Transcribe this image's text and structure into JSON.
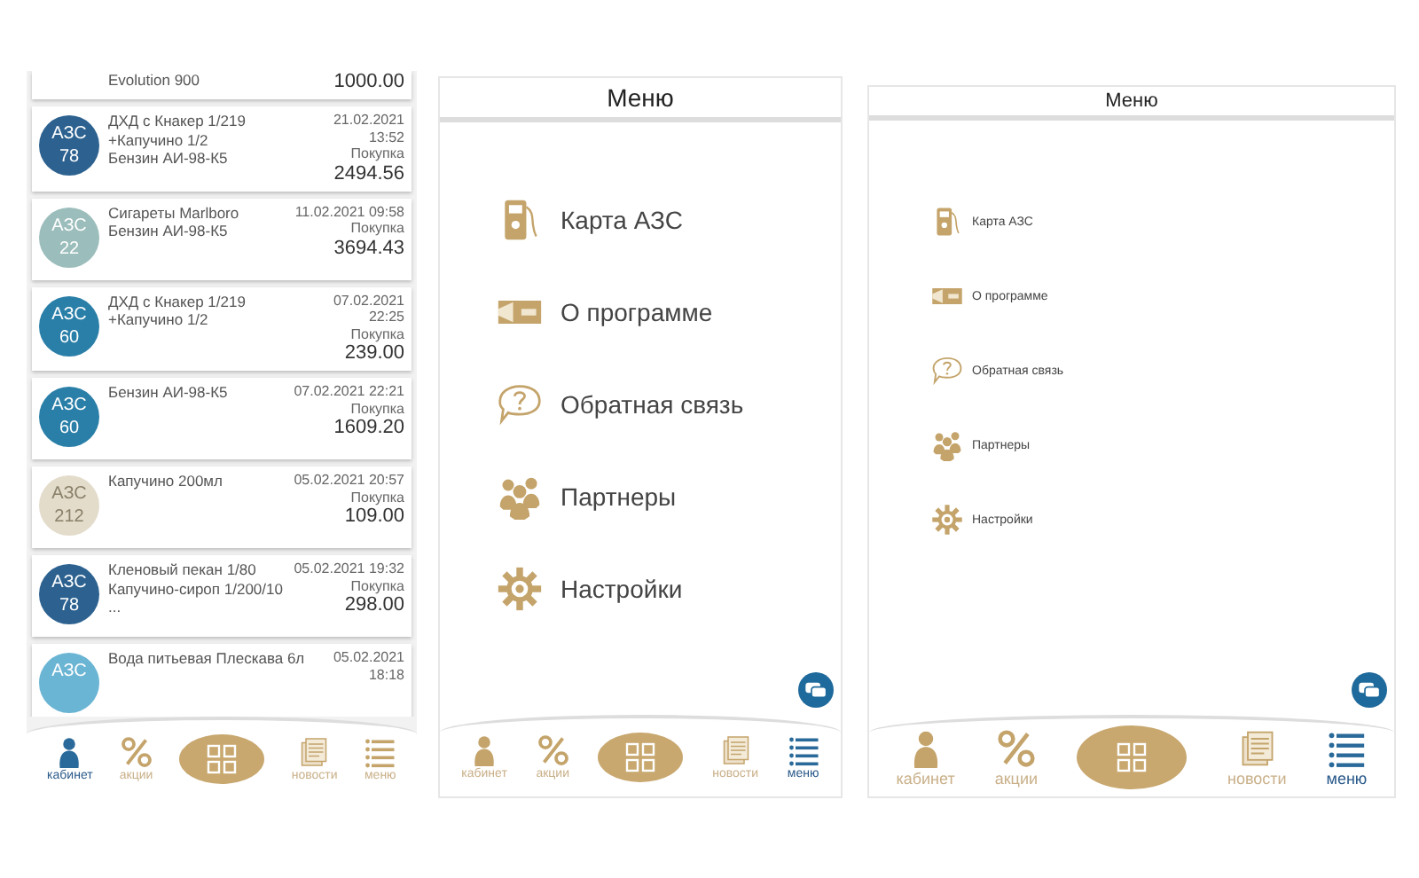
{
  "screens": [
    {
      "kind": "history",
      "transactions": [
        {
          "lines": [
            "Evolution 900"
          ],
          "amount": "1000.00"
        },
        {
          "station": "АЗС",
          "number": "78",
          "color": "#2d6290",
          "lines": [
            "ДХД с Кнакер 1/219",
            "+Капучино 1/2",
            "Бензин АИ-98-К5"
          ],
          "date": "21.02.2021",
          "time": "13:52",
          "type": "Покупка",
          "amount": "2494.56"
        },
        {
          "station": "АЗС",
          "number": "22",
          "color": "#9bbdbb",
          "lines": [
            "Сигареты Marlboro",
            "Бензин АИ-98-К5"
          ],
          "date": "11.02.2021 09:58",
          "type": "Покупка",
          "amount": "3694.43"
        },
        {
          "station": "АЗС",
          "number": "60",
          "color": "#2a7fa8",
          "lines": [
            "ДХД с Кнакер 1/219",
            "+Капучино 1/2"
          ],
          "date": "07.02.2021",
          "time": "22:25",
          "type": "Покупка",
          "amount": "239.00"
        },
        {
          "station": "АЗС",
          "number": "60",
          "color": "#2a7fa8",
          "lines": [
            "Бензин АИ-98-К5"
          ],
          "date": "07.02.2021 22:21",
          "type": "Покупка",
          "amount": "1609.20"
        },
        {
          "station": "АЗС",
          "number": "212",
          "color": "#e3dccb",
          "lines": [
            "Капучино 200мл"
          ],
          "date": "05.02.2021 20:57",
          "type": "Покупка",
          "amount": "109.00"
        },
        {
          "station": "АЗС",
          "number": "78",
          "color": "#2d6290",
          "lines": [
            "Кленовый пекан 1/80",
            "Капучино-сироп 1/200/10",
            "..."
          ],
          "date": "05.02.2021 19:32",
          "type": "Покупка",
          "amount": "298.00"
        },
        {
          "station": "АЗС",
          "color": "#6bb5d4",
          "lines": [
            "Вода питьевая Плескава 6л"
          ],
          "date": "05.02.2021",
          "time": "18:18"
        }
      ],
      "nav": [
        {
          "kind": "person",
          "label": "кабинет",
          "selected": true
        },
        {
          "kind": "percent",
          "label": "акции",
          "selected": false
        },
        {
          "kind": "qr",
          "selected": false
        },
        {
          "kind": "news",
          "label": "новости",
          "selected": false
        },
        {
          "kind": "menu",
          "label": "меню",
          "selected": false
        }
      ]
    },
    {
      "kind": "menu",
      "title": "Меню",
      "items": [
        {
          "kind": "map",
          "label": "Карта АЗС"
        },
        {
          "kind": "about",
          "label": "О программе"
        },
        {
          "kind": "feedback",
          "label": "Обратная связь"
        },
        {
          "kind": "partners",
          "label": "Партнеры"
        },
        {
          "kind": "settings",
          "label": "Настройки"
        }
      ],
      "nav": [
        {
          "kind": "person",
          "label": "кабинет",
          "selected": false
        },
        {
          "kind": "percent",
          "label": "акции",
          "selected": false
        },
        {
          "kind": "qr",
          "selected": false
        },
        {
          "kind": "news",
          "label": "новости",
          "selected": false
        },
        {
          "kind": "menu",
          "label": "меню",
          "selected": true
        }
      ]
    },
    {
      "kind": "menu",
      "title": "Меню",
      "items": [
        {
          "kind": "map",
          "label": "Карта АЗС"
        },
        {
          "kind": "about",
          "label": "О программе"
        },
        {
          "kind": "feedback",
          "label": "Обратная связь"
        },
        {
          "kind": "partners",
          "label": "Партнеры"
        },
        {
          "kind": "settings",
          "label": "Настройки"
        }
      ],
      "nav": [
        {
          "kind": "person",
          "label": "кабинет",
          "selected": false
        },
        {
          "kind": "percent",
          "label": "акции",
          "selected": false
        },
        {
          "kind": "qr",
          "selected": false
        },
        {
          "kind": "news",
          "label": "новости",
          "selected": false
        },
        {
          "kind": "menu",
          "label": "меню",
          "selected": true
        }
      ]
    }
  ]
}
